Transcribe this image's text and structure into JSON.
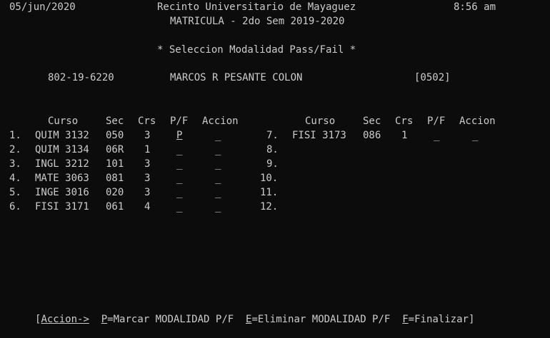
{
  "header": {
    "date": "05/jun/2020",
    "institution": "Recinto Universitario de Mayaguez",
    "time": "8:56 am",
    "subtitle": "MATRICULA - 2do Sem 2019-2020",
    "screen_title": "* Seleccion Modalidad Pass/Fail *"
  },
  "student": {
    "id": "802-19-6220",
    "name": "MARCOS R PESANTE COLON",
    "code": "[0502]"
  },
  "columns": {
    "curso": "Curso",
    "sec": "Sec",
    "crs": "Crs",
    "pf": "P/F",
    "accion": "Accion"
  },
  "rows_left": [
    {
      "num": "1.",
      "curso": "QUIM 3132",
      "sec": "050",
      "crs": "3",
      "pf": "P",
      "accion": "_"
    },
    {
      "num": "2.",
      "curso": "QUIM 3134",
      "sec": "06R",
      "crs": "1",
      "pf": "_",
      "accion": "_"
    },
    {
      "num": "3.",
      "curso": "INGL 3212",
      "sec": "101",
      "crs": "3",
      "pf": "_",
      "accion": "_"
    },
    {
      "num": "4.",
      "curso": "MATE 3063",
      "sec": "081",
      "crs": "3",
      "pf": "_",
      "accion": "_"
    },
    {
      "num": "5.",
      "curso": "INGE 3016",
      "sec": "020",
      "crs": "3",
      "pf": "_",
      "accion": "_"
    },
    {
      "num": "6.",
      "curso": "FISI 3171",
      "sec": "061",
      "crs": "4",
      "pf": "_",
      "accion": "_"
    }
  ],
  "rows_right": [
    {
      "num": "7.",
      "curso": "FISI 3173",
      "sec": "086",
      "crs": "1",
      "pf": "_",
      "accion": "_"
    },
    {
      "num": "8."
    },
    {
      "num": "9."
    },
    {
      "num": "10."
    },
    {
      "num": "11."
    },
    {
      "num": "12."
    }
  ],
  "footer": {
    "open_bracket": "[",
    "accion_label": "Accion->",
    "p_key": "P",
    "p_text": "=Marcar MODALIDAD P/F",
    "e_key": "E",
    "e_text": "=Eliminar MODALIDAD P/F",
    "f_key": "F",
    "f_text": "=Finalizar",
    "close_bracket": "]"
  }
}
